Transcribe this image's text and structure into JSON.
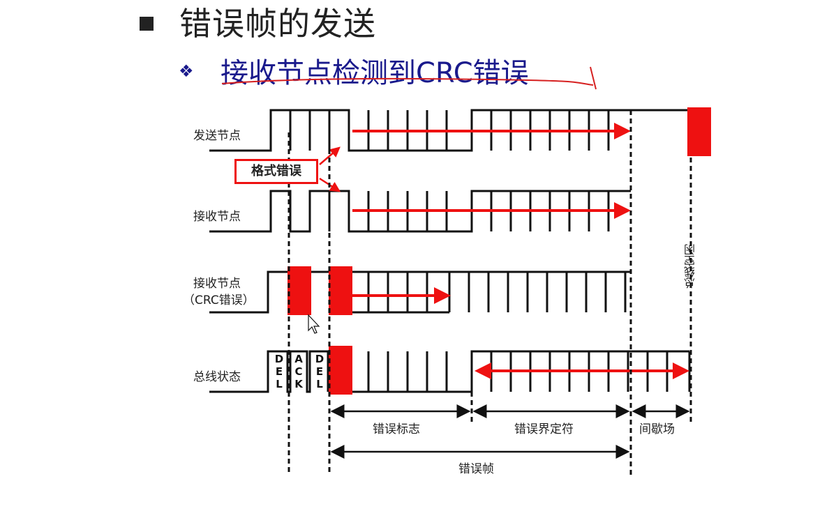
{
  "title": "错误帧的发送",
  "subtitle": "接收节点检测到CRC错误",
  "icons": {
    "title_bullet": "square-bullet-icon",
    "subtitle_bullet": "diamond-bullet-icon",
    "cursor": "mouse-pointer-icon"
  },
  "rows": {
    "sender": "发送节点",
    "receiver": "接收节点",
    "receiver_crc_line1": "接收节点",
    "receiver_crc_line2": "（CRC错误）",
    "bus": "总线状态"
  },
  "format_error": "格式错误",
  "bus_bits": {
    "del1": [
      "D",
      "E",
      "L"
    ],
    "ack": [
      "A",
      "C",
      "K"
    ],
    "del2": [
      "D",
      "E",
      "L"
    ]
  },
  "segments": {
    "error_flag": "错误标志",
    "error_delimiter": "错误界定符",
    "intermission": "间歇场",
    "error_frame": "错误帧",
    "bus_idle": "总线空闲"
  },
  "colors": {
    "accent_red": "#ee1111",
    "text_blue": "#1a1a8c"
  }
}
